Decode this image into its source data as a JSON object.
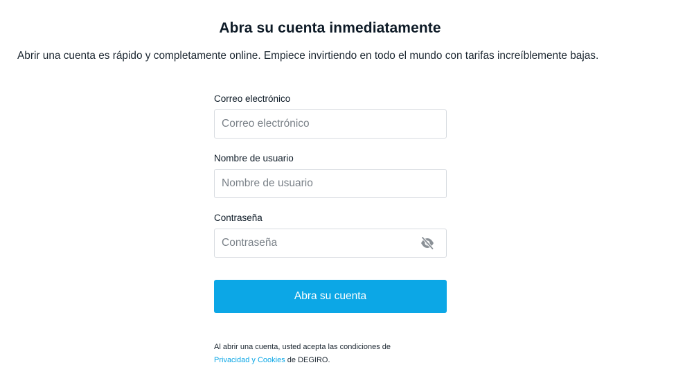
{
  "header": {
    "title": "Abra su cuenta inmediatamente",
    "subtitle": "Abrir una cuenta es rápido y completamente online. Empiece invirtiendo en todo el mundo con tarifas increíblemente bajas."
  },
  "form": {
    "email": {
      "label": "Correo electrónico",
      "placeholder": "Correo electrónico",
      "value": ""
    },
    "username": {
      "label": "Nombre de usuario",
      "placeholder": "Nombre de usuario",
      "value": ""
    },
    "password": {
      "label": "Contraseña",
      "placeholder": "Contraseña",
      "value": "",
      "toggle_icon": "eye-slash-icon"
    },
    "submit_label": "Abra su cuenta"
  },
  "legal": {
    "text_before": "Al abrir una cuenta, usted acepta las condiciones de",
    "link_text": "Privacidad y Cookies",
    "text_after": "de DEGIRO."
  },
  "colors": {
    "accent": "#0ca7e6",
    "text": "#0d1a26",
    "border": "#d7dbe0",
    "placeholder": "#7a8188",
    "icon": "#8a9096"
  }
}
